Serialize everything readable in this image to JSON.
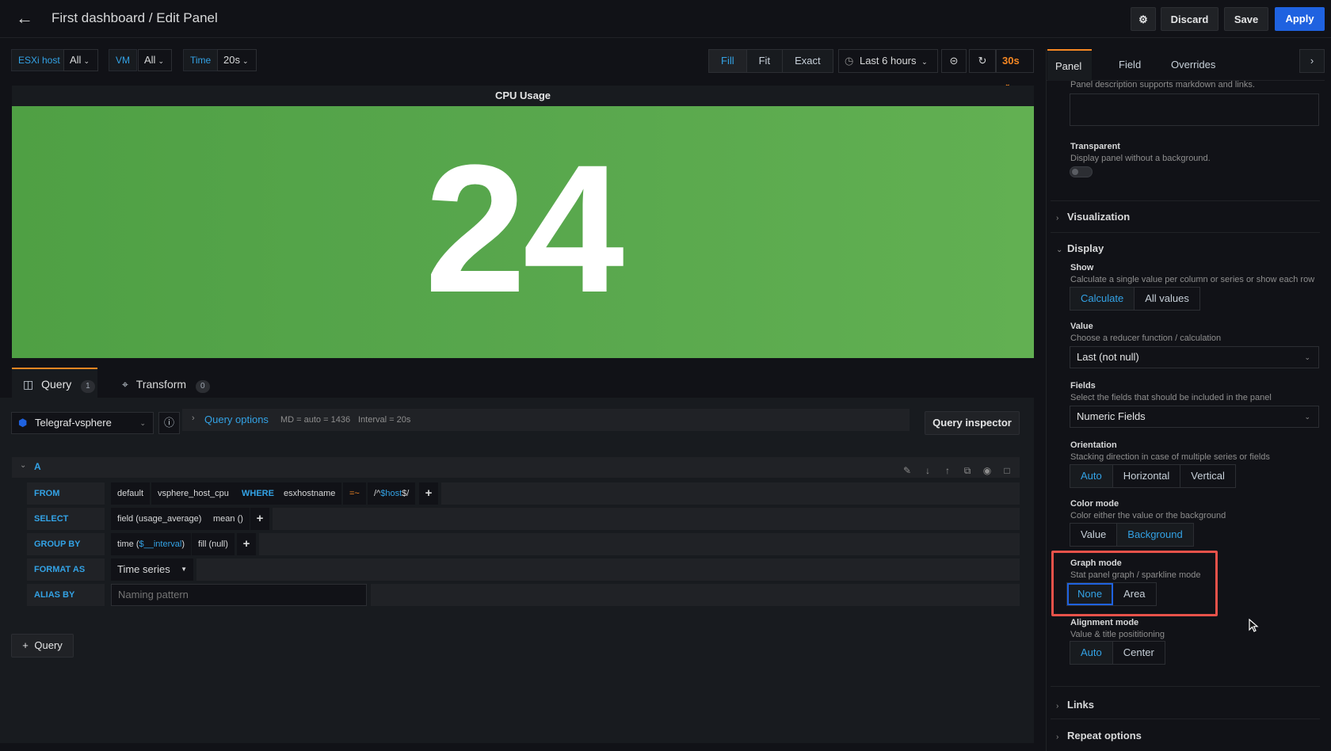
{
  "header": {
    "title": "First dashboard / Edit Panel",
    "discard_label": "Discard",
    "save_label": "Save",
    "apply_label": "Apply"
  },
  "variables": [
    {
      "label": "ESXi host",
      "value": "All"
    },
    {
      "label": "VM",
      "value": "All"
    },
    {
      "label": "Time",
      "value": "20s"
    }
  ],
  "view_modes": [
    "Fill",
    "Fit",
    "Exact"
  ],
  "view_mode_active": "Fill",
  "time_picker": {
    "range": "Last 6 hours",
    "refresh": "30s"
  },
  "panel": {
    "title": "CPU Usage",
    "value": "24",
    "color": "#56a64b"
  },
  "bottom_tabs": [
    {
      "label": "Query",
      "count": "1"
    },
    {
      "label": "Transform",
      "count": "0"
    }
  ],
  "query_editor": {
    "datasource": "Telegraf-vsphere",
    "options_label": "Query options",
    "md_text": "MD = auto = 1436",
    "interval_text": "Interval = 20s",
    "inspector_label": "Query inspector",
    "ref_id": "A",
    "from": {
      "keyword": "FROM",
      "policy": "default",
      "measurement": "vsphere_host_cpu",
      "where": "WHERE",
      "tag": "esxhostname",
      "op": "=~",
      "value_prefix": "/^",
      "value_var": "$host",
      "value_suffix": "$/"
    },
    "select": {
      "keyword": "SELECT",
      "field": "field (usage_average)",
      "fn": "mean ()"
    },
    "group_by": {
      "keyword": "GROUP BY",
      "time_prefix": "time (",
      "time_var": "$__interval",
      "time_suffix": ")",
      "fill": "fill (null)"
    },
    "format_as": {
      "keyword": "FORMAT AS",
      "value": "Time series"
    },
    "alias_by": {
      "keyword": "ALIAS BY",
      "placeholder": "Naming pattern"
    },
    "add_query_label": "Query"
  },
  "sidebar": {
    "tabs": [
      "Panel",
      "Field",
      "Overrides"
    ],
    "active_tab": "Panel",
    "description_hint": "Panel description supports markdown and links.",
    "transparent": {
      "label": "Transparent",
      "desc": "Display panel without a background.",
      "on": false
    },
    "sections": {
      "visualization": "Visualization",
      "display": "Display",
      "links": "Links",
      "repeat": "Repeat options"
    },
    "show": {
      "label": "Show",
      "desc": "Calculate a single value per column or series or show each row",
      "options": [
        "Calculate",
        "All values"
      ],
      "active": "Calculate"
    },
    "value": {
      "label": "Value",
      "desc": "Choose a reducer function / calculation",
      "selected": "Last (not null)"
    },
    "fields": {
      "label": "Fields",
      "desc": "Select the fields that should be included in the panel",
      "selected": "Numeric Fields"
    },
    "orientation": {
      "label": "Orientation",
      "desc": "Stacking direction in case of multiple series or fields",
      "options": [
        "Auto",
        "Horizontal",
        "Vertical"
      ],
      "active": "Auto"
    },
    "color_mode": {
      "label": "Color mode",
      "desc": "Color either the value or the background",
      "options": [
        "Value",
        "Background"
      ],
      "active": "Background"
    },
    "graph_mode": {
      "label": "Graph mode",
      "desc": "Stat panel graph / sparkline mode",
      "options": [
        "None",
        "Area"
      ],
      "active": "None"
    },
    "alignment_mode": {
      "label": "Alignment mode",
      "desc": "Value & title posititioning",
      "options": [
        "Auto",
        "Center"
      ],
      "active": "Auto"
    }
  },
  "colors": {
    "accent": "#33a2e5",
    "apply": "#1f62e0",
    "highlight": "#e8524a",
    "tab_active": "#f58723"
  }
}
